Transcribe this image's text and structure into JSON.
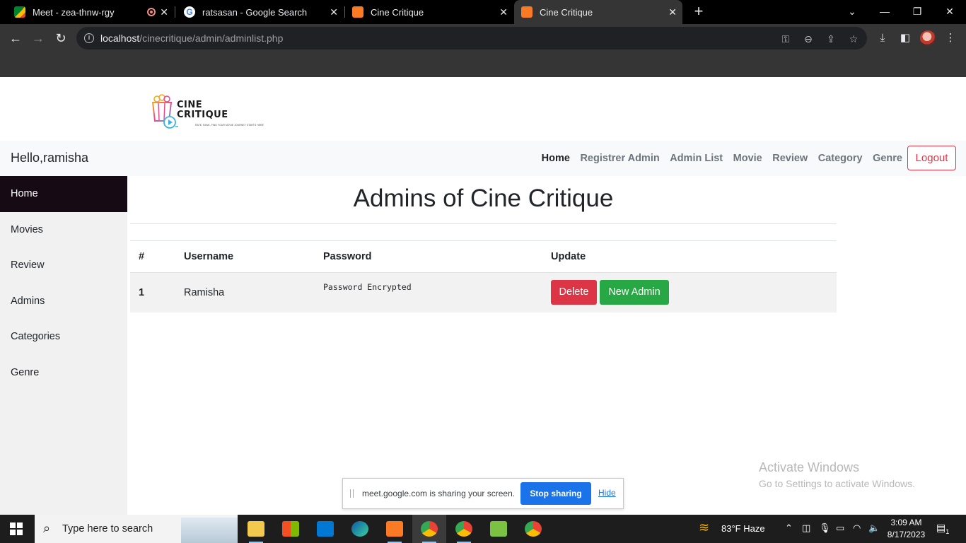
{
  "browser": {
    "tabs": [
      {
        "title": "Meet - zea-thnw-rgy",
        "icon": "google-meet-icon"
      },
      {
        "title": "ratsasan - Google Search",
        "icon": "google-icon"
      },
      {
        "title": "Cine Critique",
        "icon": "xampp-icon"
      },
      {
        "title": "Cine Critique",
        "icon": "xampp-icon"
      }
    ],
    "url_host": "localhost",
    "url_path": "/cinecritique/admin/adminlist.php"
  },
  "site": {
    "logo_line1": "CINE",
    "logo_line2": "CRITIQUE",
    "logo_tagline": "RATE, RANK, FIND YOUR MOVIE JOURNEY STARTS HERE"
  },
  "navbar": {
    "greeting": "Hello,ramisha",
    "links": [
      "Home",
      "Registrer Admin",
      "Admin List",
      "Movie",
      "Review",
      "Category",
      "Genre"
    ],
    "logout": "Logout"
  },
  "sidebar": {
    "items": [
      "Home",
      "Movies",
      "Review",
      "Admins",
      "Categories",
      "Genre"
    ]
  },
  "main": {
    "title": "Admins of Cine Critique",
    "table": {
      "headers": [
        "#",
        "Username",
        "Password",
        "Update"
      ],
      "rows": [
        {
          "num": "1",
          "username": "Ramisha",
          "password": "Password Encrypted",
          "delete": "Delete",
          "new": "New Admin"
        }
      ]
    }
  },
  "watermark": {
    "line1": "Activate Windows",
    "line2": "Go to Settings to activate Windows."
  },
  "share_bar": {
    "message": "meet.google.com is sharing your screen.",
    "stop": "Stop sharing",
    "hide": "Hide"
  },
  "taskbar": {
    "search_placeholder": "Type here to search",
    "weather": "83°F  Haze",
    "time": "3:09 AM",
    "date": "8/17/2023",
    "notifications": "1"
  },
  "colors": {
    "active_sidebar": "#160b14",
    "danger": "#dc3545",
    "success": "#28a745",
    "share_blue": "#1a73e8"
  }
}
